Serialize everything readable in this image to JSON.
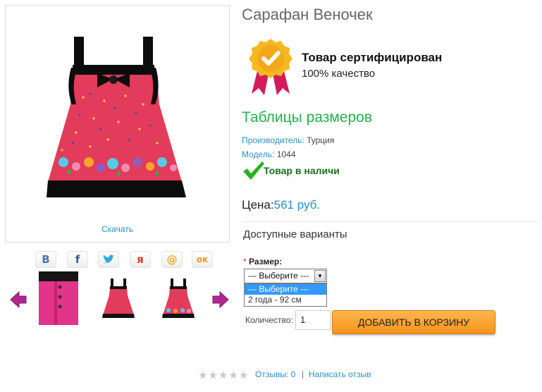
{
  "product": {
    "title": "Сарафан Веночек",
    "download_label": "Скачать",
    "certificate": {
      "title": "Товар сертифицирован",
      "subtitle": "100% качество",
      "icon": "certificate-badge-icon"
    },
    "size_table_link": "Таблицы размеров",
    "manufacturer_label": "Производитель:",
    "manufacturer_value": "Турция",
    "model_label": "Модель:",
    "model_value": "1044",
    "stock_text": "Товар в наличи",
    "price_label": "Цена:",
    "price_value": "561 руб.",
    "variants_title": "Доступные варианты",
    "size_required_mark": "*",
    "size_label": "Размер:",
    "size_select": {
      "selected": "--- Выберите ---",
      "options": [
        "--- Выберите ---",
        "2 года - 92 см"
      ]
    },
    "quantity_label": "Количество:",
    "quantity_value": "1",
    "add_to_cart_label": "ДОБАВИТЬ В КОРЗИНУ"
  },
  "social": {
    "vk": "В",
    "facebook": "f",
    "twitter": "t",
    "odnoklassniki_alt": "я",
    "mail": "@",
    "ok": "ок"
  },
  "reviews": {
    "rating": 0,
    "max_rating": 5,
    "reviews_link": "Отзывы: 0",
    "separator": "|",
    "write_review_link": "Написать отзыв"
  },
  "colors": {
    "link": "#2a8fc9",
    "green": "#22b14c",
    "cart_button": "#f7941d",
    "dress_red": "#e33b5b"
  }
}
